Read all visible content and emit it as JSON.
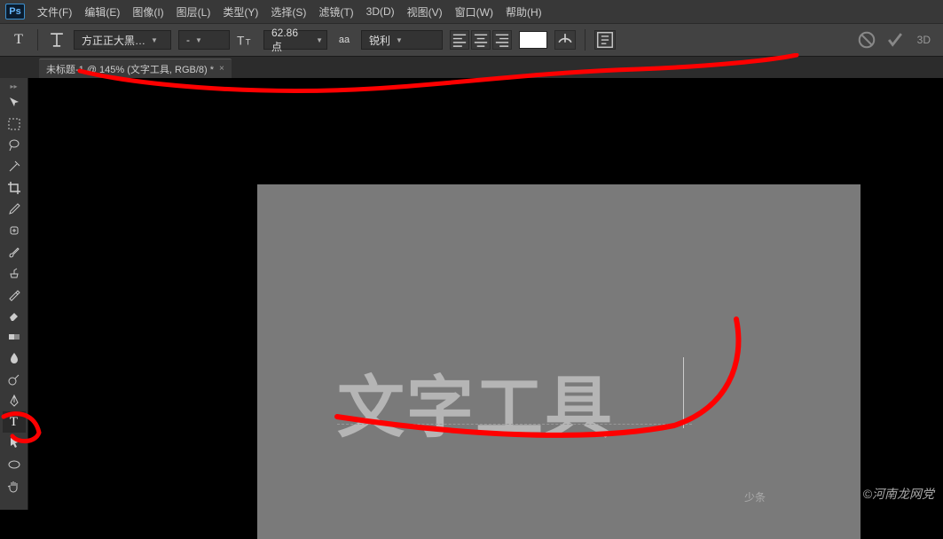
{
  "app": {
    "logo": "Ps"
  },
  "menus": [
    {
      "label": "文件(F)"
    },
    {
      "label": "编辑(E)"
    },
    {
      "label": "图像(I)"
    },
    {
      "label": "图层(L)"
    },
    {
      "label": "类型(Y)"
    },
    {
      "label": "选择(S)"
    },
    {
      "label": "滤镜(T)"
    },
    {
      "label": "3D(D)"
    },
    {
      "label": "视图(V)"
    },
    {
      "label": "窗口(W)"
    },
    {
      "label": "帮助(H)"
    }
  ],
  "options": {
    "tool_letter": "T",
    "font_family": "方正正大黑…",
    "font_style": "-",
    "size_value": "62.86 点",
    "aa_label": "aa",
    "aa_value": "锐利",
    "color_swatch": "#ffffff",
    "threeD": "3D"
  },
  "tab": {
    "title": "未标题-1 @ 145% (文字工具, RGB/8) *",
    "close": "×"
  },
  "canvas": {
    "text": "文字工具"
  },
  "watermark": {
    "brand": "少条",
    "text": "©河南龙网党"
  },
  "tools_count": 19
}
